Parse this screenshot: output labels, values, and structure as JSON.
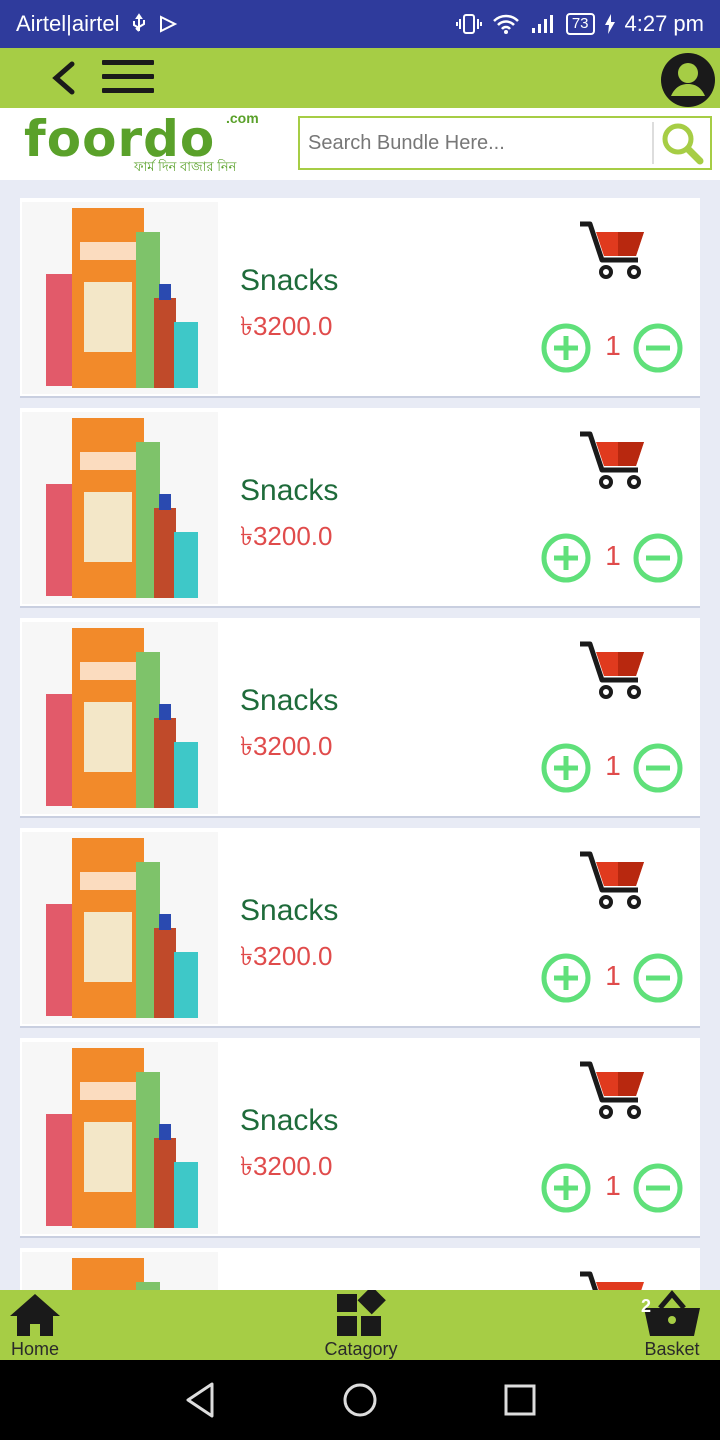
{
  "status_bar": {
    "carrier": "Airtel|airtel",
    "battery": "73",
    "time": "4:27 pm"
  },
  "header": {
    "logo_text": "foordo",
    "logo_suffix": ".com",
    "logo_tagline": "ফার্ম দিন বাজার নিন",
    "search_placeholder": "Search Bundle Here..."
  },
  "products": [
    {
      "name": "Snacks",
      "price": "৳3200.0",
      "qty": "1"
    },
    {
      "name": "Snacks",
      "price": "৳3200.0",
      "qty": "1"
    },
    {
      "name": "Snacks",
      "price": "৳3200.0",
      "qty": "1"
    },
    {
      "name": "Snacks",
      "price": "৳3200.0",
      "qty": "1"
    },
    {
      "name": "Snacks",
      "price": "৳3200.0",
      "qty": "1"
    }
  ],
  "bottom_nav": {
    "home": "Home",
    "category": "Catagory",
    "basket": "Basket",
    "basket_count": "2"
  },
  "colors": {
    "accent": "#a6cd45",
    "status_bar": "#2f3b9c",
    "price": "#e04b4b",
    "name": "#1e6b3a",
    "qty_button": "#5fe07a",
    "cart": "#e03a1e"
  }
}
